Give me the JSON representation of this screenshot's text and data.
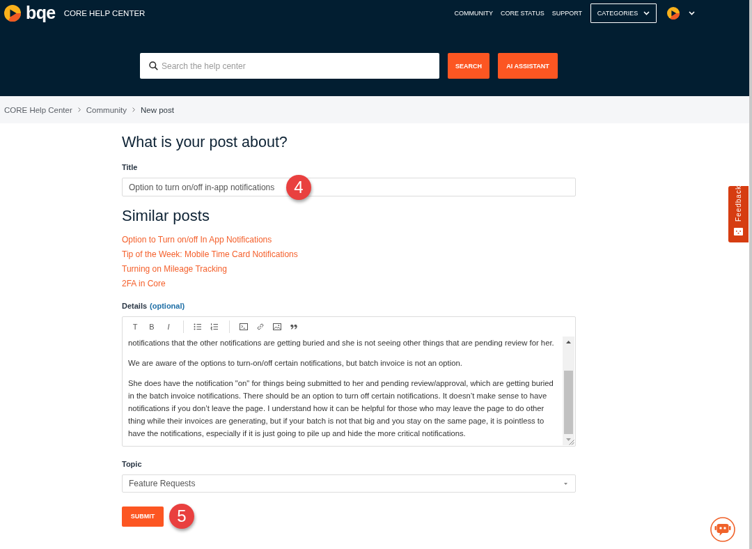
{
  "header": {
    "logo": {
      "text": "bqe"
    },
    "site_title": "CORE HELP CENTER",
    "nav": [
      {
        "label": "COMMUNITY"
      },
      {
        "label": "CORE STATUS"
      },
      {
        "label": "SUPPORT"
      }
    ],
    "categories_menu": {
      "label": "CATEGORIES"
    }
  },
  "search": {
    "placeholder": "Search the help center",
    "buttons": [
      {
        "label": "SEARCH"
      },
      {
        "label": "AI ASSISTANT"
      }
    ]
  },
  "breadcrumbs": [
    {
      "label": "CORE Help Center"
    },
    {
      "label": "Community"
    },
    {
      "label": "New post"
    }
  ],
  "form": {
    "heading": "What is your post about?",
    "title_field": {
      "label": "Title",
      "value": "Option to turn on/off in-app notifications",
      "annotation": "4"
    },
    "similar_posts": {
      "heading": "Similar posts",
      "links": [
        {
          "label": "Option to Turn on/off In App Notifications"
        },
        {
          "label": "Tip of the Week: Mobile Time Card Notifications"
        },
        {
          "label": "Turning on Mileage Tracking"
        },
        {
          "label": "2FA in Core"
        }
      ]
    },
    "details": {
      "label": "Details",
      "label_note": "(optional)",
      "format_buttons": [
        "T",
        "B",
        "I"
      ],
      "paragraphs": [
        "notifications that the other notifications are getting buried and she is not seeing other things that are pending review for her.",
        "We are aware of the options to turn-on/off certain notifications, but batch invoice is not an option.",
        "She does have the notification \"on\" for things being submitted to her and pending review/approval, which are getting buried in the batch invoice notifications. There should be an option to turn off certain notifications. It doesn’t make sense to have notifications if you don’t leave the page. I understand how it can be helpful for those who may leave the page to do other thing while their invoices are generating, but if your batch is not that big and you stay on the same page, it is pointless to have the notifications, especially if it is just going to pile up and hide the more critical notifications."
      ]
    },
    "topic": {
      "label": "Topic",
      "value": "Feature Requests"
    },
    "submit": {
      "label": "SUBMIT",
      "annotation": "5"
    }
  },
  "feedback_tab": {
    "label": "Feedback"
  }
}
